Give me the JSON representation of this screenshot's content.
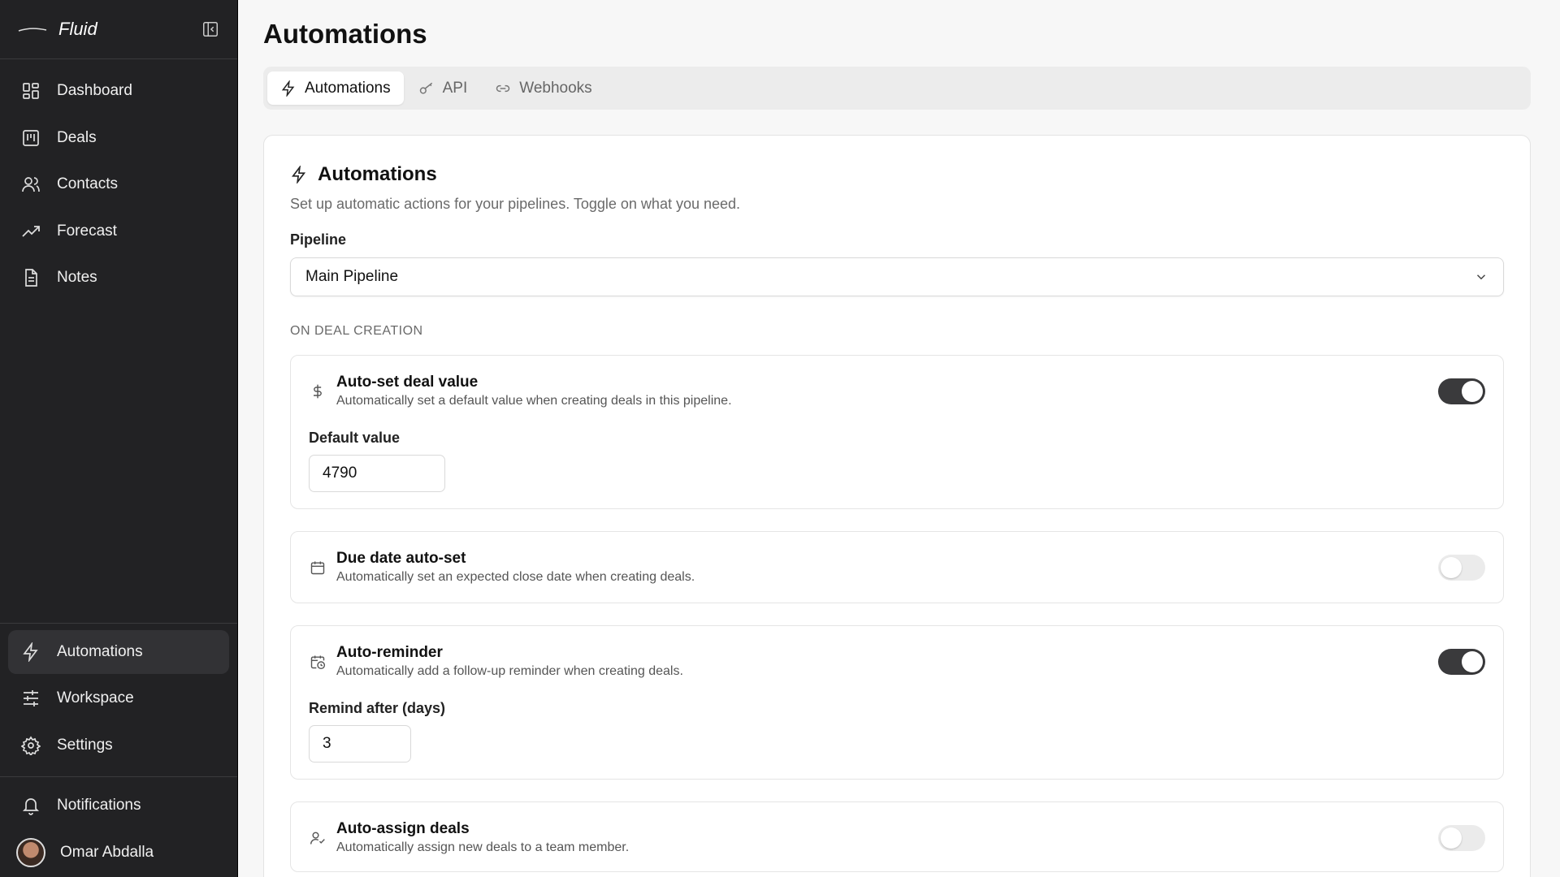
{
  "app": {
    "name": "Fluid"
  },
  "sidebar": {
    "items": [
      {
        "label": "Dashboard",
        "icon": "dashboard-icon"
      },
      {
        "label": "Deals",
        "icon": "deals-icon"
      },
      {
        "label": "Contacts",
        "icon": "contacts-icon"
      },
      {
        "label": "Forecast",
        "icon": "forecast-icon"
      },
      {
        "label": "Notes",
        "icon": "notes-icon"
      }
    ],
    "bottom_items": [
      {
        "label": "Automations",
        "icon": "lightning-icon",
        "active": true
      },
      {
        "label": "Workspace",
        "icon": "sliders-icon"
      },
      {
        "label": "Settings",
        "icon": "gear-icon"
      }
    ],
    "notifications_label": "Notifications",
    "user_name": "Omar Abdalla"
  },
  "page": {
    "title": "Automations"
  },
  "tabs": [
    {
      "label": "Automations",
      "icon": "lightning-icon",
      "active": true
    },
    {
      "label": "API",
      "icon": "key-icon"
    },
    {
      "label": "Webhooks",
      "icon": "link-icon"
    }
  ],
  "card": {
    "title": "Automations",
    "description": "Set up automatic actions for your pipelines. Toggle on what you need.",
    "pipeline_label": "Pipeline",
    "pipeline_value": "Main Pipeline",
    "section_title": "ON DEAL CREATION"
  },
  "rules": [
    {
      "title": "Auto-set deal value",
      "subtitle": "Automatically set a default value when creating deals in this pipeline.",
      "icon": "dollar-icon",
      "enabled": true,
      "field_label": "Default value",
      "field_value": "4790"
    },
    {
      "title": "Due date auto-set",
      "subtitle": "Automatically set an expected close date when creating deals.",
      "icon": "calendar-icon",
      "enabled": false
    },
    {
      "title": "Auto-reminder",
      "subtitle": "Automatically add a follow-up reminder when creating deals.",
      "icon": "calendar-clock-icon",
      "enabled": true,
      "field_label": "Remind after (days)",
      "field_value": "3"
    },
    {
      "title": "Auto-assign deals",
      "subtitle": "Automatically assign new deals to a team member.",
      "icon": "user-check-icon",
      "enabled": false
    }
  ],
  "colors": {
    "sidebar_bg": "#222224",
    "active_bg": "#323235",
    "toggle_on": "#3a3a3c",
    "toggle_off": "#ebebeb"
  }
}
